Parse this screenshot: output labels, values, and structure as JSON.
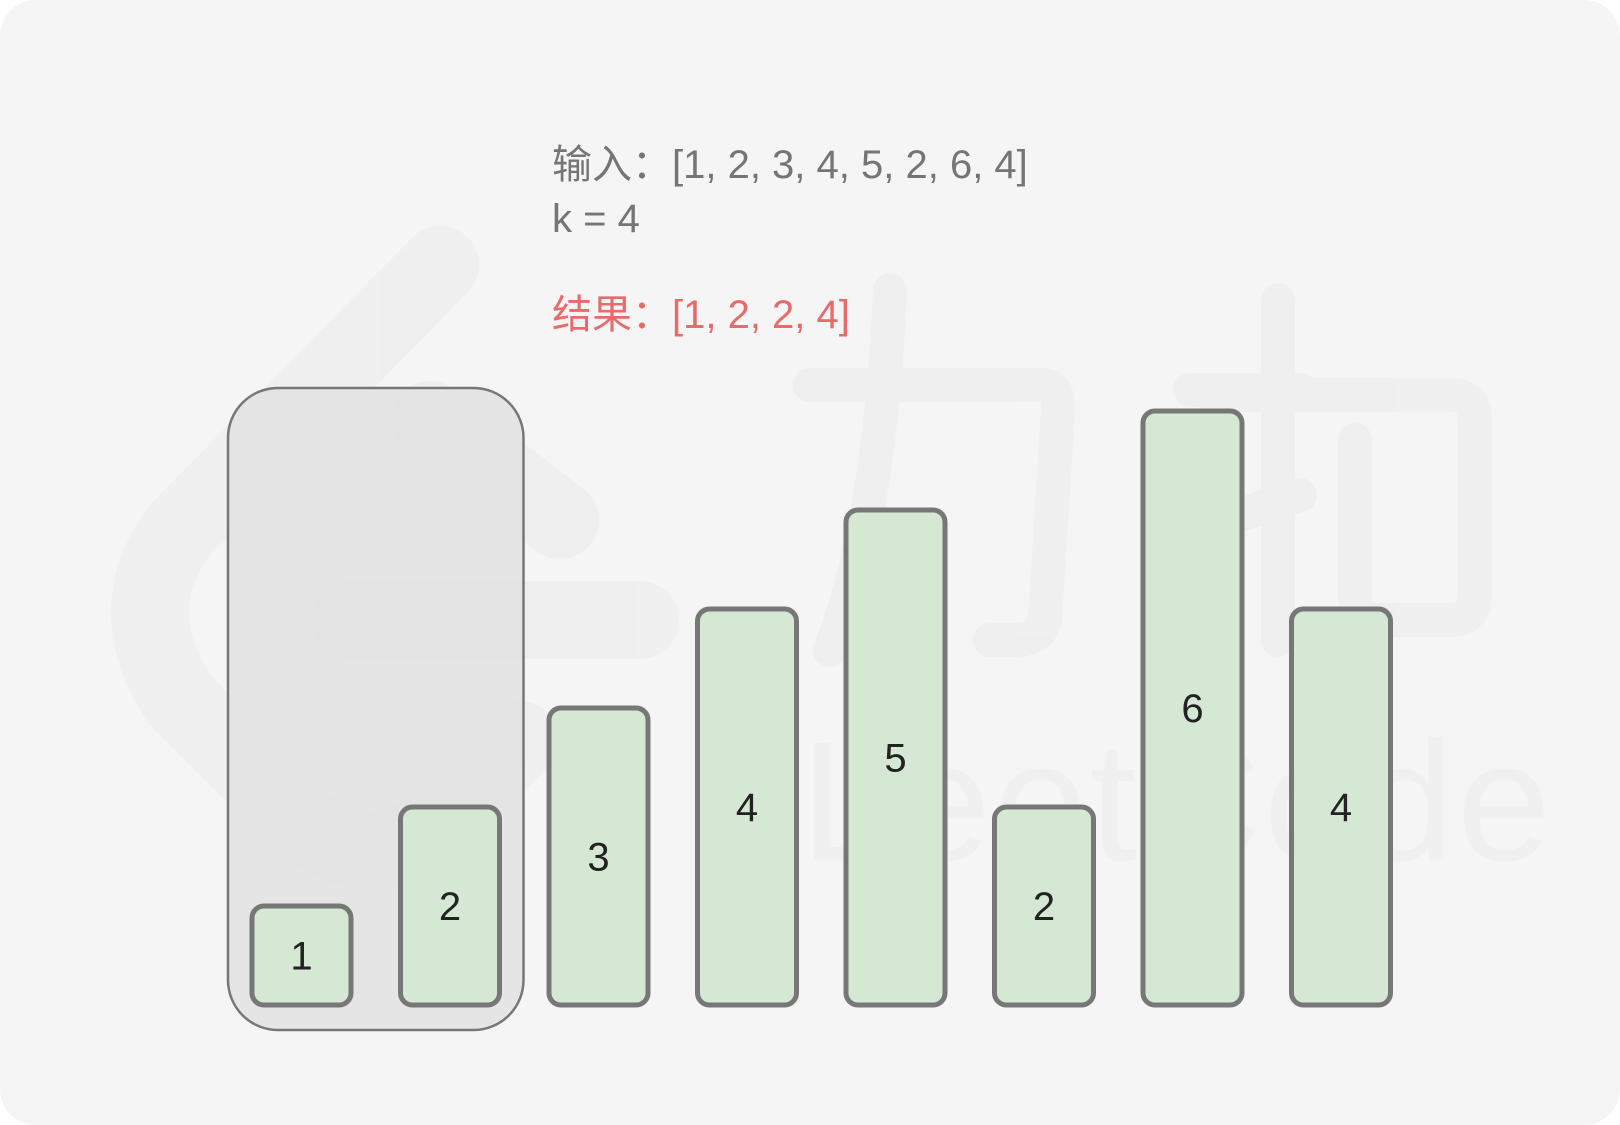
{
  "input_line": "输入：[1, 2, 3, 4, 5, 2, 6, 4]",
  "k_line": "k = 4",
  "result_line": "结果：[1, 2, 2, 4]",
  "array": [
    1,
    2,
    3,
    4,
    5,
    2,
    6,
    4
  ],
  "window": {
    "start": 0,
    "length": 2
  },
  "watermark": {
    "logo_text": "力扣",
    "wordmark": "LeetCode"
  },
  "colors": {
    "background": "#f5f5f5",
    "text": "#757575",
    "result": "#e96a6a",
    "bar_fill": "#d5e8d4",
    "bar_stroke": "#777777",
    "window_fill": "#e0e0e0",
    "window_stroke": "#777777"
  }
}
